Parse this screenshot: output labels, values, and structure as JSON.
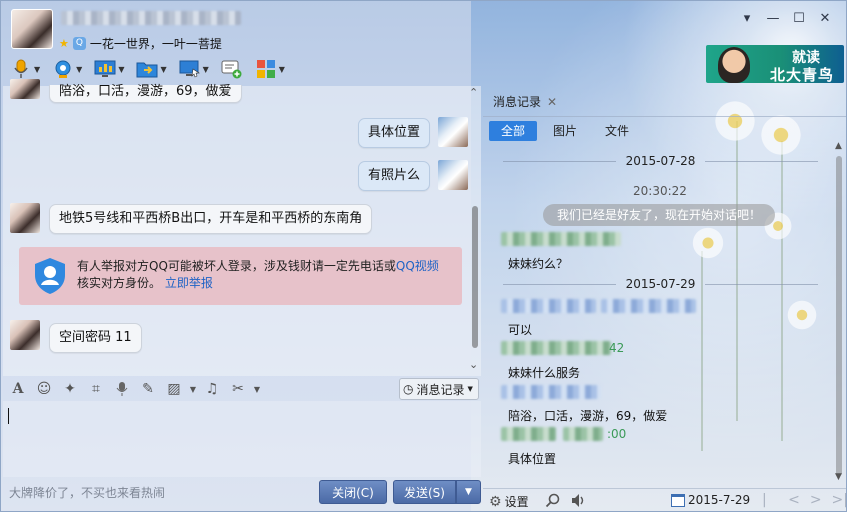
{
  "header": {
    "signature": "一花一世界，一叶一菩提"
  },
  "ad_banner": {
    "line1": "就读",
    "line2": "北大青鸟"
  },
  "chat": {
    "messages": [
      {
        "side": "left",
        "text": "陪浴，口活，漫游，69，做爱"
      },
      {
        "side": "right",
        "text": "具体位置"
      },
      {
        "side": "right",
        "text": "有照片么"
      },
      {
        "side": "left",
        "text": "地铁5号线和平西桥B出口，开车是和平西桥的东南角"
      },
      {
        "side": "left",
        "text": "空间密码  11"
      }
    ],
    "warning": {
      "text": "有人举报对方QQ可能被坏人登录，涉及钱财请一定先电话或",
      "link1": "QQ视频",
      "text2": "核实对方身份。",
      "link2": "立即举报"
    }
  },
  "input": {
    "history_button": "消息记录",
    "ad_text": "大牌降价了，不买也来看热闹",
    "close_button": "关闭(C)",
    "send_button": "发送(S)"
  },
  "history": {
    "tab_label": "消息记录",
    "filters": [
      "全部",
      "图片",
      "文件"
    ],
    "date1": "2015-07-28",
    "time1": "20:30:22",
    "system_message": "我们已经是好友了，现在开始对话吧！",
    "msg1": "妹妹约么？",
    "date2": "2015-07-29",
    "msg2": "可以",
    "tail2": "42",
    "msg3": "妹妹什么服务",
    "msg4": "陪浴，口活，漫游，69，做爱",
    "tail4": ":00",
    "msg5": "具体位置",
    "settings": "设置",
    "current_date": "2015-7-29"
  },
  "colors": {
    "accent": "#2e7fde",
    "send_button": "#4b6aa6",
    "warning_bg": "#e9b2b8",
    "link": "#1f63c5"
  }
}
